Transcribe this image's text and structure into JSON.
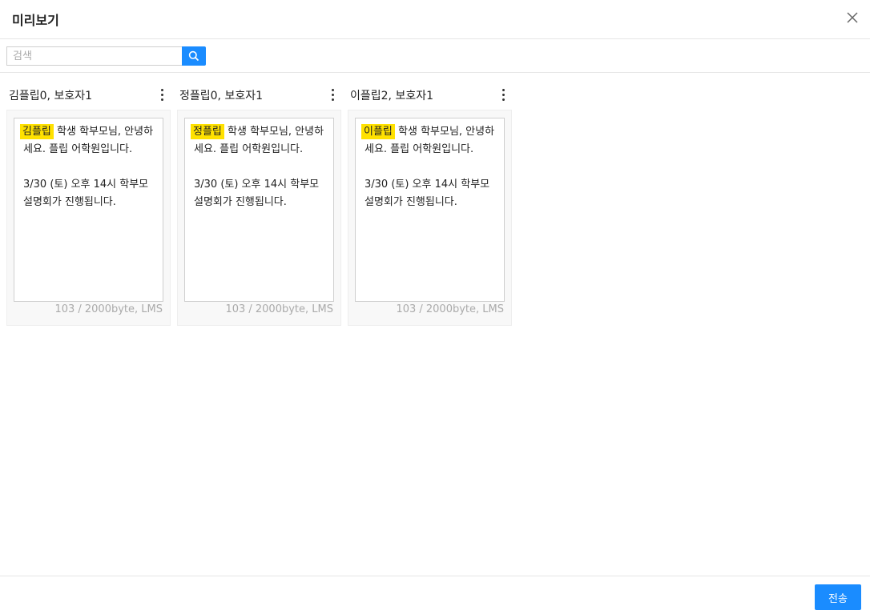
{
  "dialog": {
    "title": "미리보기"
  },
  "search": {
    "placeholder": "검색",
    "value": ""
  },
  "previews": [
    {
      "recipient": "김플립0, 보호자1",
      "highlight": "김플립",
      "message": " 학생 학부모님, 안녕하세요. 플립 어학원입니다.\n\n3/30 (토) 오후 14시 학부모 설명회가 진행됩니다.",
      "byte_info": "103 / 2000byte, LMS"
    },
    {
      "recipient": "정플립0, 보호자1",
      "highlight": "정플립",
      "message": " 학생 학부모님, 안녕하세요. 플립 어학원입니다.\n\n3/30 (토) 오후 14시 학부모 설명회가 진행됩니다.",
      "byte_info": "103 / 2000byte, LMS"
    },
    {
      "recipient": "이플립2, 보호자1",
      "highlight": "이플립",
      "message": " 학생 학부모님, 안녕하세요. 플립 어학원입니다.\n\n3/30 (토) 오후 14시 학부모 설명회가 진행됩니다.",
      "byte_info": "103 / 2000byte, LMS"
    }
  ],
  "footer": {
    "send_label": "전송"
  },
  "colors": {
    "accent": "#1a8cff",
    "highlight": "#ffe100",
    "card_bg": "#f8f8f8"
  },
  "icons": {
    "close": "close-icon",
    "search": "search-icon",
    "more": "more-vertical-icon"
  }
}
